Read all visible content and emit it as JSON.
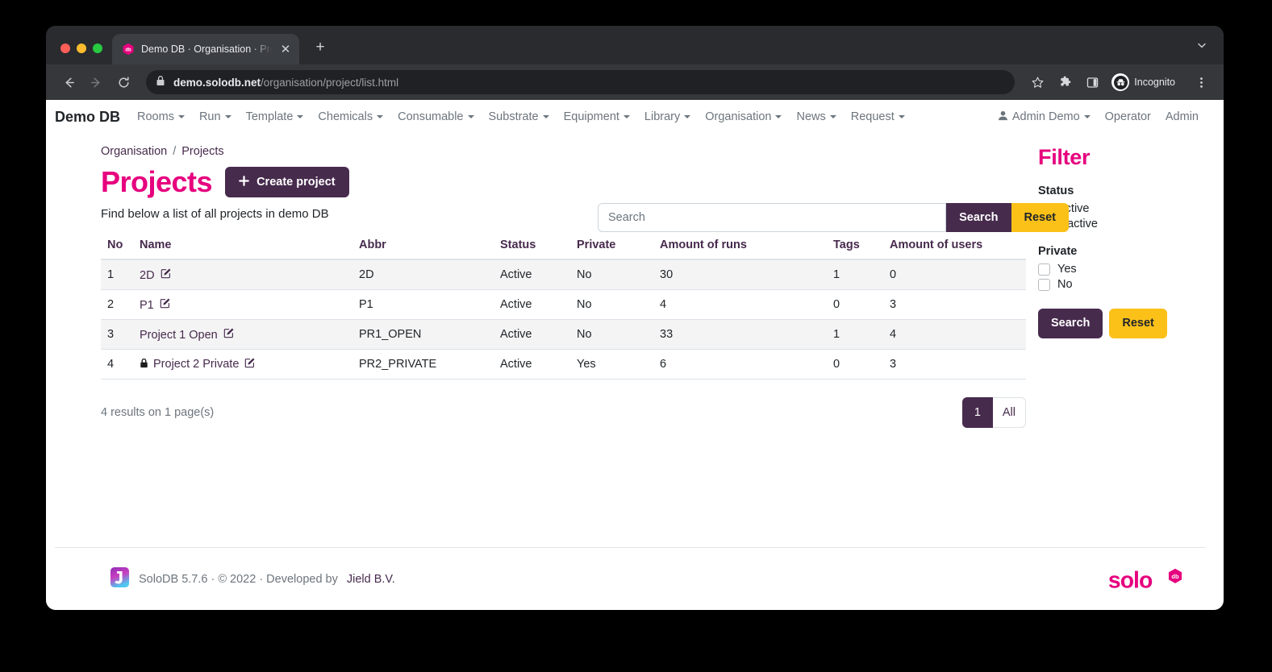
{
  "browser": {
    "tab": {
      "title": "Demo DB · Organisation · Proje",
      "favicon_name": "solodb-hex-favicon",
      "close_label": "✕"
    },
    "newtab_label": "+",
    "tabstrip_menu_icon": "chevron-down-icon",
    "toolbar": {
      "back_icon": "back-arrow-icon",
      "forward_icon": "forward-arrow-icon",
      "reload_icon": "reload-icon",
      "lock_icon": "lock-icon",
      "url_host": "demo.solodb.net",
      "url_path": "/organisation/project/list.html",
      "bookmark_icon": "star-icon",
      "extensions_icon": "puzzle-piece-icon",
      "sidepanel_icon": "side-panel-icon",
      "profile_label": "Incognito",
      "profile_icon": "incognito-hat-icon",
      "menu_icon": "three-dot-menu-icon"
    }
  },
  "sitenav": {
    "brand": "Demo DB",
    "items": [
      {
        "label": "Rooms",
        "caret": true
      },
      {
        "label": "Run",
        "caret": true
      },
      {
        "label": "Template",
        "caret": true
      },
      {
        "label": "Chemicals",
        "caret": true
      },
      {
        "label": "Consumable",
        "caret": true
      },
      {
        "label": "Substrate",
        "caret": true
      },
      {
        "label": "Equipment",
        "caret": true
      },
      {
        "label": "Library",
        "caret": true
      },
      {
        "label": "Organisation",
        "caret": true
      },
      {
        "label": "News",
        "caret": true
      },
      {
        "label": "Request",
        "caret": true
      }
    ],
    "right": {
      "user_icon": "user-icon",
      "user_label": "Admin Demo",
      "operator_label": "Operator",
      "admin_label": "Admin"
    }
  },
  "breadcrumb": {
    "parent": "Organisation",
    "separator": "/",
    "current": "Projects"
  },
  "page": {
    "title": "Projects",
    "create_button": "Create project",
    "create_button_icon": "plus-icon",
    "lead": "Find below a list of all projects in demo DB"
  },
  "search": {
    "placeholder": "Search",
    "value": "",
    "search_label": "Search",
    "reset_label": "Reset"
  },
  "table": {
    "columns": [
      "No",
      "Name",
      "Abbr",
      "Status",
      "Private",
      "Amount of runs",
      "Tags",
      "Amount of users"
    ],
    "rows": [
      {
        "no": "1",
        "name": "2D",
        "private_lock": false,
        "abbr": "2D",
        "status": "Active",
        "private": "No",
        "runs": "30",
        "tags": "1",
        "users": "0"
      },
      {
        "no": "2",
        "name": "P1",
        "private_lock": false,
        "abbr": "P1",
        "status": "Active",
        "private": "No",
        "runs": "4",
        "tags": "0",
        "users": "3"
      },
      {
        "no": "3",
        "name": "Project 1 Open",
        "private_lock": false,
        "abbr": "PR1_OPEN",
        "status": "Active",
        "private": "No",
        "runs": "33",
        "tags": "1",
        "users": "4"
      },
      {
        "no": "4",
        "name": "Project 2 Private",
        "private_lock": true,
        "abbr": "PR2_PRIVATE",
        "status": "Active",
        "private": "Yes",
        "runs": "6",
        "tags": "0",
        "users": "3"
      }
    ],
    "edit_icon": "pen-to-square-icon",
    "lock_icon": "lock-icon"
  },
  "results": {
    "text": "4 results on 1 page(s)",
    "pages": [
      {
        "label": "1",
        "active": true
      },
      {
        "label": "All",
        "active": false
      }
    ]
  },
  "filter": {
    "title": "Filter",
    "groups": [
      {
        "label": "Status",
        "options": [
          {
            "label": "Active",
            "checked": false
          },
          {
            "label": "Inactive",
            "checked": false
          }
        ]
      },
      {
        "label": "Private",
        "options": [
          {
            "label": "Yes",
            "checked": false
          },
          {
            "label": "No",
            "checked": false
          }
        ]
      }
    ],
    "search_label": "Search",
    "reset_label": "Reset"
  },
  "footer": {
    "logo_icon": "jield-j-logo-icon",
    "text": "SoloDB 5.7.6 · © 2022 · Developed by ",
    "link": "Jield B.V.",
    "brand_logo": "solo-db-logo",
    "brand_text": "solo",
    "brand_badge": "db"
  },
  "colors": {
    "accent_pink": "#e6007e",
    "accent_purple": "#472b4d",
    "accent_yellow": "#fbc119",
    "muted": "#6c757d"
  }
}
